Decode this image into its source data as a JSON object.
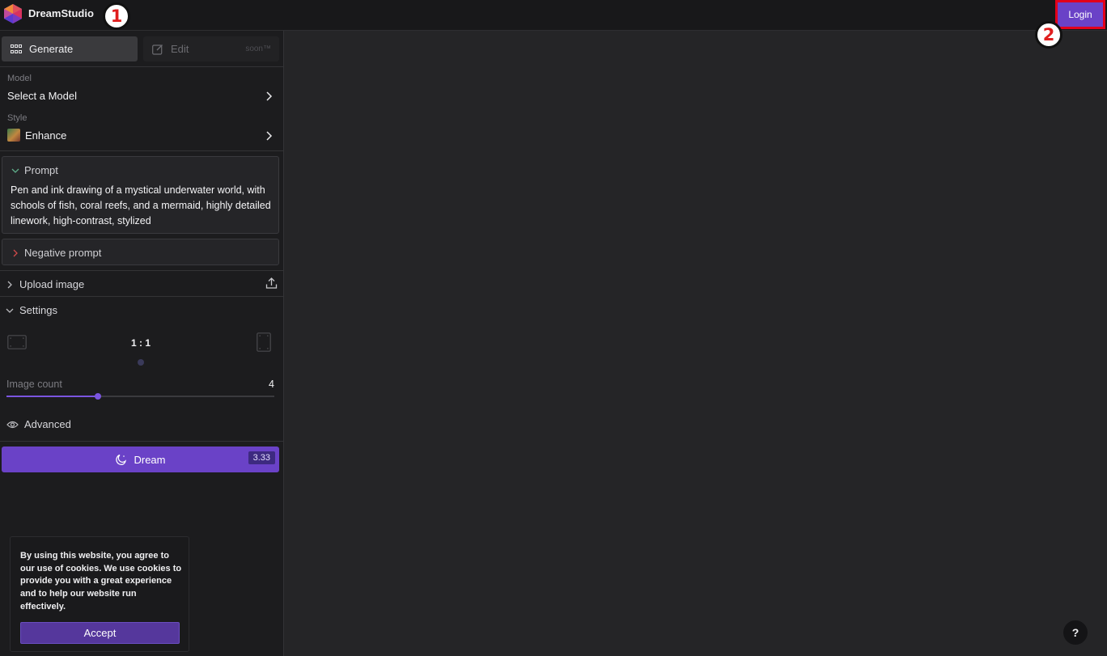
{
  "app": {
    "name": "DreamStudio"
  },
  "annotations": {
    "marker_1": "1",
    "marker_2": "2"
  },
  "header": {
    "login_label": "Login"
  },
  "tabs": {
    "generate_label": "Generate",
    "edit_label": "Edit",
    "edit_badge": "soon™"
  },
  "model": {
    "label": "Model",
    "value": "Select a Model"
  },
  "style": {
    "label": "Style",
    "value": "Enhance"
  },
  "prompt": {
    "label": "Prompt",
    "text": "Pen and ink drawing of a mystical underwater world, with schools of fish, coral reefs, and a mermaid, highly detailed linework, high-contrast, stylized"
  },
  "negative_prompt": {
    "label": "Negative prompt"
  },
  "upload": {
    "label": "Upload image"
  },
  "settings": {
    "label": "Settings",
    "aspect_ratio": "1 : 1",
    "image_count_label": "Image count",
    "image_count_value": "4",
    "image_count_fraction": 0.342,
    "advanced_label": "Advanced"
  },
  "dream": {
    "label": "Dream",
    "credits": "3.33"
  },
  "cookie": {
    "text": "By using this website, you agree to our use of cookies. We use cookies to provide you with a great experience and to help our website run effectively.",
    "accept_label": "Accept"
  },
  "help": {
    "label": "?"
  },
  "colors": {
    "accent": "#6a42c7",
    "background": "#252527",
    "sidebar": "#1c1c1e"
  }
}
